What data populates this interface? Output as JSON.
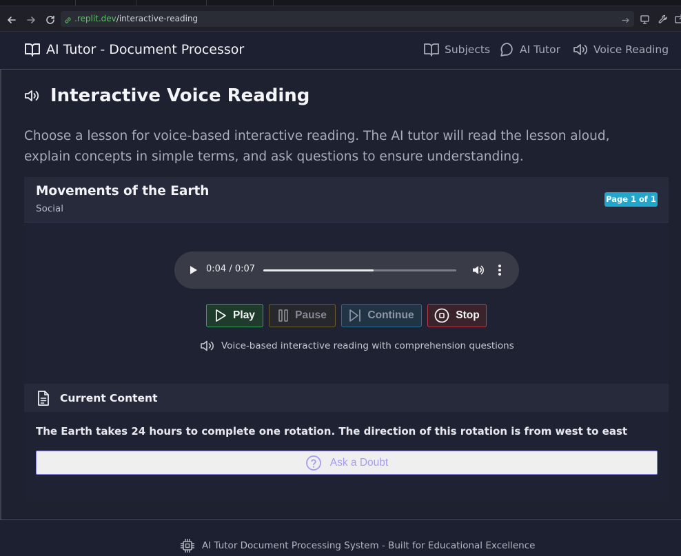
{
  "browser": {
    "url_domain": ".replit.dev",
    "url_path": "/interactive-reading"
  },
  "header": {
    "brand_title": "AI Tutor - Document Processor",
    "nav": {
      "subjects": "Subjects",
      "ai_tutor": "AI Tutor",
      "voice_reading": "Voice Reading"
    }
  },
  "page": {
    "title": "Interactive Voice Reading",
    "intro": "Choose a lesson for voice-based interactive reading. The AI tutor will read the lesson aloud, explain concepts in simple terms, and ask questions to ensure understanding."
  },
  "lesson": {
    "title": "Movements of the Earth",
    "subject": "Social",
    "page_badge": "Page 1 of 1"
  },
  "player": {
    "time": "0:04 / 0:07",
    "progress": 0.57
  },
  "controls": {
    "play": "Play",
    "pause": "Pause",
    "continue": "Continue",
    "stop": "Stop"
  },
  "voice_note": "Voice-based interactive reading with comprehension questions",
  "content": {
    "heading": "Current Content",
    "text": "The Earth takes 24 hours to complete one rotation. The direction of this rotation is from west to east",
    "ask_doubt": "Ask a Doubt"
  },
  "footer": {
    "text": "AI Tutor Document Processing System - Built for Educational Excellence"
  },
  "colors": {
    "play_border": "#3aa15b",
    "pause_border": "#6b5d2f",
    "continue_border": "#2f6a91",
    "stop_border": "#b63d49",
    "badge": "#22a6cc",
    "ask_doubt": "#a59df5"
  },
  "icons": {
    "brand": "open-book-icon",
    "subjects": "open-book-icon",
    "ai_tutor": "chat-bubble-icon",
    "voice_reading": "speaker-icon",
    "title": "speaker-icon",
    "play": "play-triangle-icon",
    "pause": "pause-icon",
    "continue": "skip-forward-icon",
    "stop": "stop-circle-icon",
    "content": "document-icon",
    "ask_doubt": "question-circle-icon",
    "footer": "chip-icon"
  }
}
